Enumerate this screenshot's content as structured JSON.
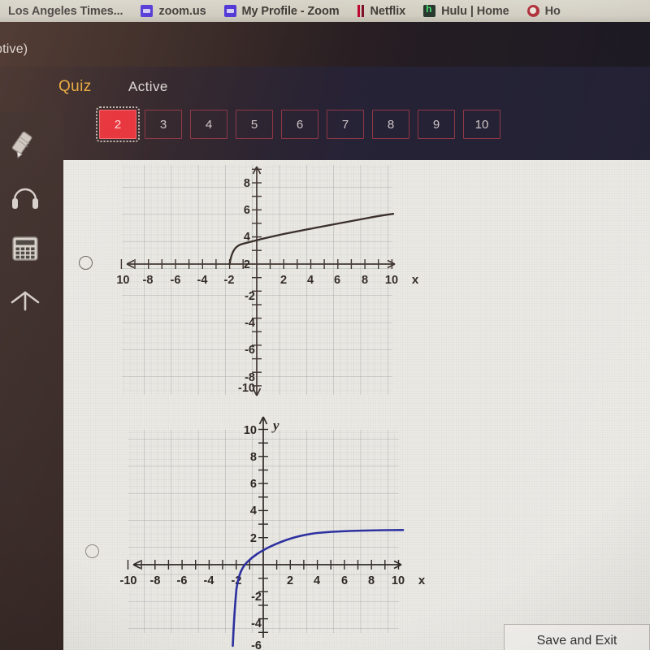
{
  "browser": {
    "bookmarks": [
      {
        "label": "Los Angeles Times...",
        "icon": "none"
      },
      {
        "label": "zoom.us",
        "icon": "zoom-icon"
      },
      {
        "label": "My Profile - Zoom",
        "icon": "zoom-icon"
      },
      {
        "label": "Netflix",
        "icon": "netflix-icon"
      },
      {
        "label": "Hulu | Home",
        "icon": "hulu-icon"
      },
      {
        "label": "Ho",
        "icon": "home-icon"
      }
    ]
  },
  "header": {
    "truncated_title": "ptive)",
    "quiz_label": "Quiz",
    "status_label": "Active",
    "accent_color": "#e8a93c",
    "current_question": "2",
    "question_numbers": [
      "2",
      "3",
      "4",
      "5",
      "6",
      "7",
      "8",
      "9",
      "10"
    ]
  },
  "tools": [
    {
      "name": "highlighter-icon"
    },
    {
      "name": "headphones-icon"
    },
    {
      "name": "calculator-icon"
    },
    {
      "name": "arrow-up-icon"
    }
  ],
  "footer": {
    "save_and_exit_label": "Save and Exit"
  },
  "answers": [
    {
      "id": "option-a",
      "selected": false
    },
    {
      "id": "option-b",
      "selected": false
    }
  ],
  "chart_data": [
    {
      "id": "graph-option-a",
      "type": "line",
      "title": "",
      "xlabel": "x",
      "ylabel": "",
      "xlim": [
        -11.5,
        11.5
      ],
      "ylim": [
        -11,
        9
      ],
      "grid": true,
      "curve_color": "#3a2f2b",
      "xticks": [
        -10,
        -8,
        -6,
        -4,
        -2,
        2,
        4,
        6,
        8,
        10
      ],
      "xtick_labels": [
        "-10",
        "-8",
        "-6",
        "-4",
        "-2",
        "2",
        "4",
        "6",
        "8",
        "10"
      ],
      "yticks": [
        8,
        6,
        4,
        2,
        -2,
        -4,
        -6,
        -8,
        -10
      ],
      "ytick_labels": [
        "8",
        "6",
        "4",
        "2",
        "-2",
        "-4",
        "-6",
        "-8",
        "-10"
      ],
      "description": "square-root style curve starting at (-2, 0)",
      "x": [
        -2,
        -1.75,
        -1.5,
        -1,
        -0.5,
        0,
        0.5,
        1,
        2,
        3,
        4,
        5,
        6,
        7,
        8,
        9,
        10,
        10.6
      ],
      "y": [
        0,
        0.95,
        1.25,
        1.6,
        1.82,
        2.0,
        2.15,
        2.28,
        2.5,
        2.68,
        2.85,
        3.0,
        3.12,
        3.25,
        3.38,
        3.5,
        3.62,
        3.7
      ]
    },
    {
      "id": "graph-option-b",
      "type": "line",
      "title": "",
      "xlabel": "x",
      "ylabel": "y",
      "xlim": [
        -11.5,
        11.5
      ],
      "ylim": [
        -6.5,
        11
      ],
      "grid": true,
      "curve_color": "#2b2f9e",
      "xticks": [
        -10,
        -8,
        -6,
        -4,
        -2,
        2,
        4,
        6,
        8,
        10
      ],
      "xtick_labels": [
        "-10",
        "-8",
        "-6",
        "-4",
        "-2",
        "2",
        "4",
        "6",
        "8",
        "10"
      ],
      "yticks": [
        10,
        8,
        6,
        4,
        2,
        -2,
        -4,
        -6
      ],
      "ytick_labels": [
        "10",
        "8",
        "6",
        "4",
        "2",
        "-2",
        "-4",
        "-6"
      ],
      "description": "logarithmic curve with vertical asymptote near x = -2.3 approaching y = 2.5",
      "x": [
        -2.25,
        -2.2,
        -2.1,
        -2.0,
        -1.8,
        -1.5,
        -1.0,
        -0.5,
        0,
        0.5,
        1,
        2,
        3,
        4,
        5,
        6,
        7,
        8,
        9,
        10,
        11
      ],
      "y": [
        -6.0,
        -4.6,
        -3.3,
        -2.3,
        -1.2,
        -0.45,
        0.4,
        0.95,
        1.3,
        1.55,
        1.75,
        2.0,
        2.18,
        2.3,
        2.38,
        2.42,
        2.45,
        2.47,
        2.48,
        2.49,
        2.5
      ]
    }
  ]
}
